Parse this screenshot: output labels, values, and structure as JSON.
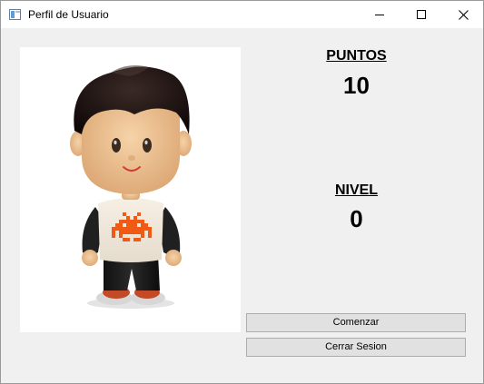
{
  "window": {
    "title": "Perfil de Usuario"
  },
  "stats": {
    "points_label": "PUNTOS",
    "points_value": "10",
    "level_label": "NIVEL",
    "level_value": "0"
  },
  "actions": {
    "start_label": "Comenzar",
    "logout_label": "Cerrar Sesion"
  },
  "colors": {
    "window_bg": "#f0f0f0",
    "shirt_invader": "#f05a14"
  }
}
